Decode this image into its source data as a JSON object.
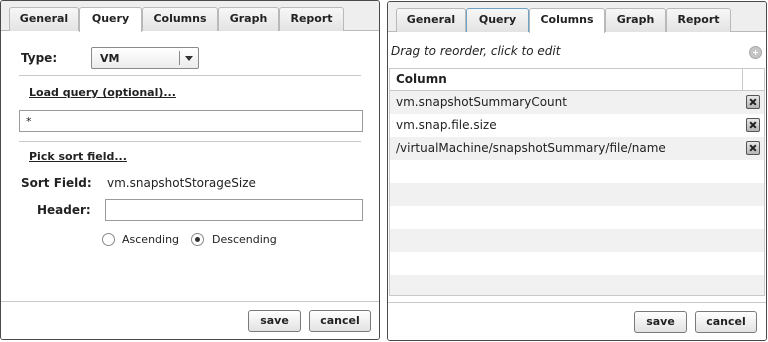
{
  "left": {
    "tabs": [
      "General",
      "Query",
      "Columns",
      "Graph",
      "Report"
    ],
    "active_tab": "Query",
    "type_label": "Type:",
    "type_value": "VM",
    "load_query_link": "Load query (optional)...",
    "query_value": "*",
    "pick_sort_link": "Pick sort field...",
    "sort_field_label": "Sort Field:",
    "sort_field_value": "vm.snapshotStorageSize",
    "header_label": "Header:",
    "header_value": "",
    "sort_options": [
      {
        "label": "Ascending",
        "checked": false
      },
      {
        "label": "Descending",
        "checked": true
      }
    ],
    "save_label": "save",
    "cancel_label": "cancel"
  },
  "right": {
    "tabs": [
      "General",
      "Query",
      "Columns",
      "Graph",
      "Report"
    ],
    "active_tab": "Columns",
    "hint": "Drag to reorder, click to edit",
    "column_header": "Column",
    "rows": [
      "vm.snapshotSummaryCount",
      "vm.snap.file.size",
      "/virtualMachine/snapshotSummary/file/name"
    ],
    "save_label": "save",
    "cancel_label": "cancel"
  }
}
